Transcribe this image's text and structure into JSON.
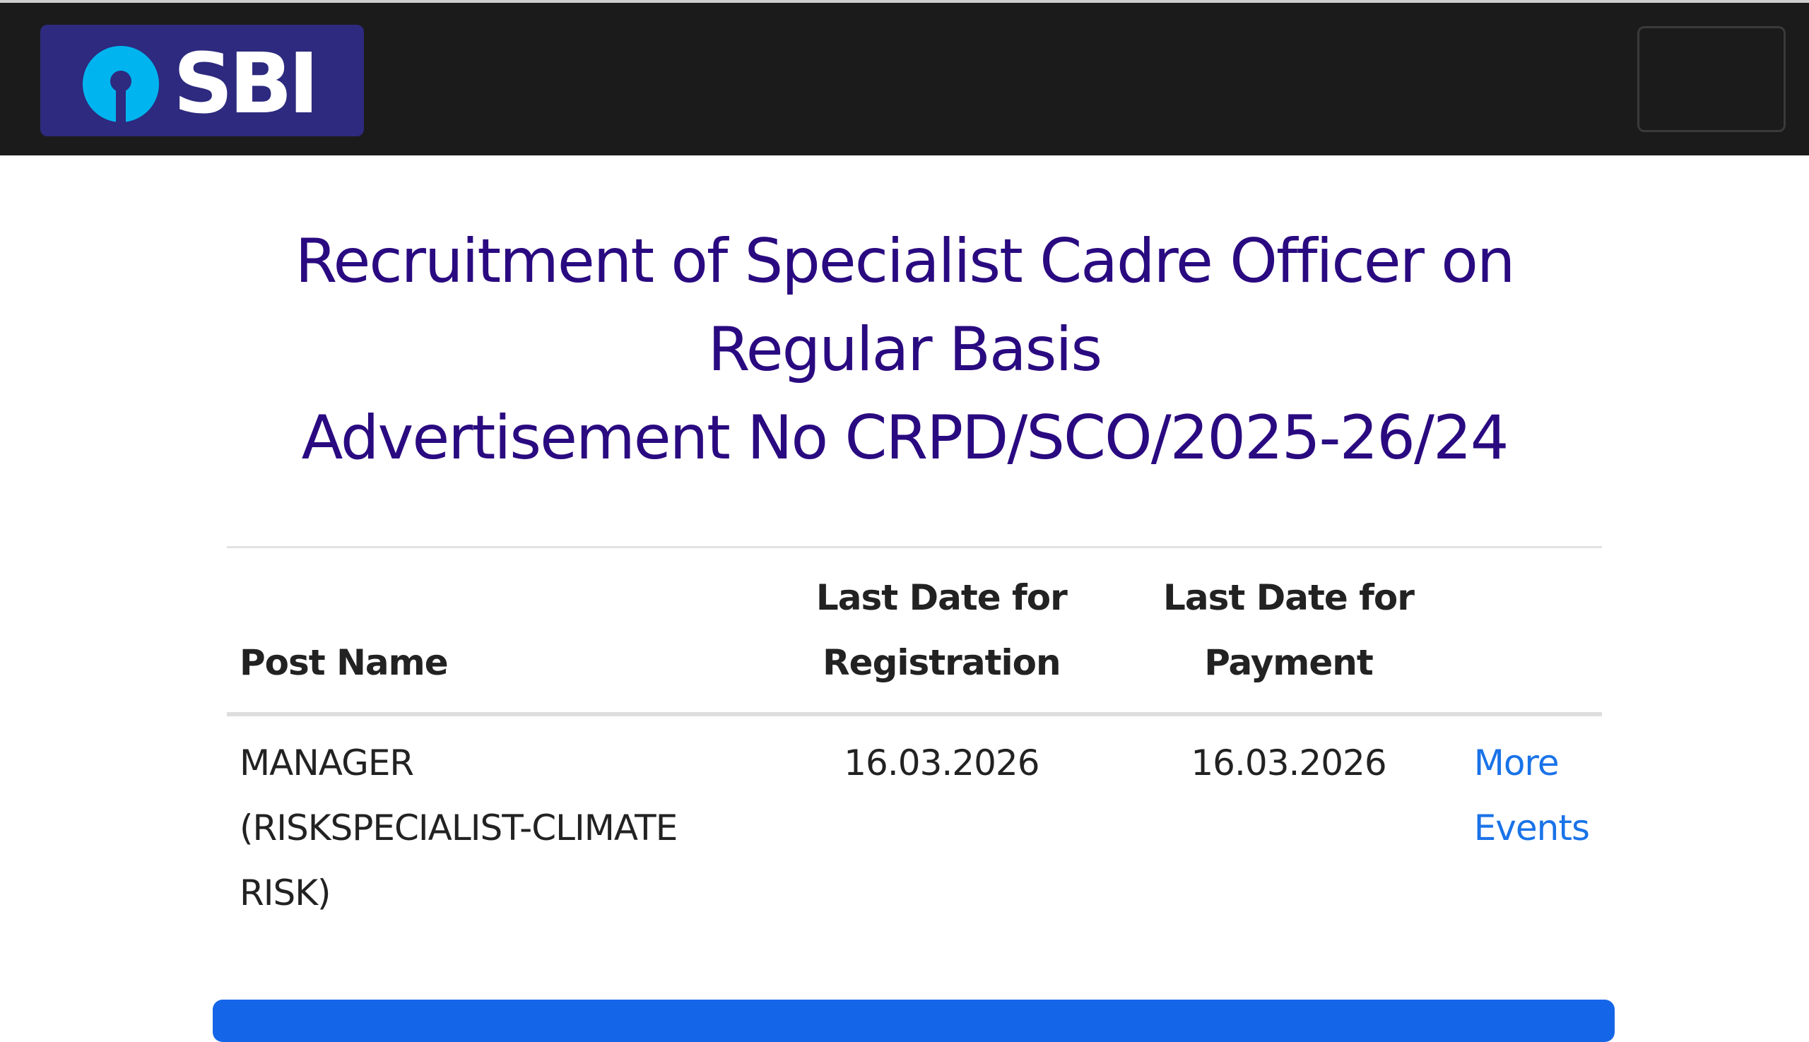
{
  "navbar": {
    "logo_text": "SBI",
    "brand_color": "#2d2a7f",
    "logo_icon": "sbi-keyhole-icon",
    "menu_toggle_icon": "menu-toggle"
  },
  "header": {
    "title_line1": "Recruitment of Specialist Cadre Officer on",
    "title_line2": "Regular Basis",
    "title_line3": "Advertisement No CRPD/SCO/2025-26/24",
    "title_color": "#2a0a80"
  },
  "table": {
    "columns": {
      "post_name": "Post Name",
      "reg_line1": "Last Date for",
      "reg_line2": "Registration",
      "pay_line1": "Last Date for",
      "pay_line2": "Payment",
      "more": ""
    },
    "rows": [
      {
        "post_line1": "MANAGER",
        "post_line2": "(RISKSPECIALIST-CLIMATE",
        "post_line3": "RISK)",
        "registration_date": "16.03.2026",
        "payment_date": "16.03.2026",
        "more_line1": "More",
        "more_line2": "Events"
      }
    ]
  },
  "link_color": "#1a73e8",
  "button_color": "#1565e8"
}
